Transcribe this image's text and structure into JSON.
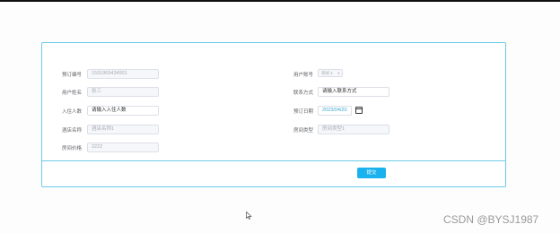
{
  "form": {
    "order_no": {
      "label": "预订编号",
      "value": "1591869434901"
    },
    "user_account": {
      "label": "用户账号",
      "value": "测试-1"
    },
    "user_name": {
      "label": "用户姓名",
      "value": "张三"
    },
    "contact": {
      "label": "联系方式",
      "placeholder": "请输入联系方式"
    },
    "guests": {
      "label": "入住人数",
      "placeholder": "请输入入住人数"
    },
    "booking_date": {
      "label": "预订日期",
      "value": "2023/04/20",
      "icon": "calendar-icon"
    },
    "hotel_name": {
      "label": "酒店名称",
      "value": "酒店名称1"
    },
    "room_type": {
      "label": "房间类型",
      "value": "房间类型1"
    },
    "room_price": {
      "label": "房间价格",
      "value": "2222"
    }
  },
  "actions": {
    "submit_label": "提交"
  },
  "watermark": {
    "text": "CSDN @BYSJ1987"
  },
  "colors": {
    "accent": "#1ab2ee",
    "border": "#6ecbe8"
  }
}
